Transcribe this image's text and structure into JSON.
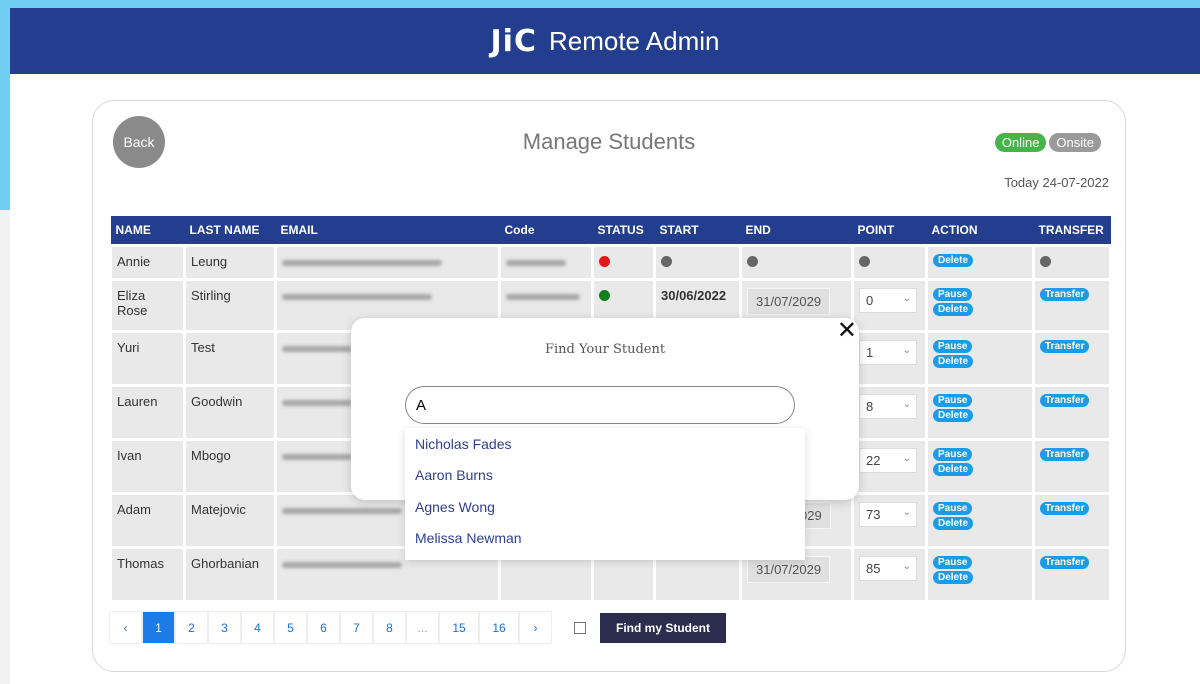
{
  "header": {
    "logo": "JiC",
    "title": "Remote Admin"
  },
  "card": {
    "back_label": "Back",
    "title": "Manage Students",
    "toggles": {
      "online": "Online",
      "onsite": "Onsite"
    },
    "today": "Today 24-07-2022"
  },
  "table": {
    "columns": [
      "NAME",
      "LAST NAME",
      "EMAIL",
      "Code",
      "STATUS",
      "START",
      "END",
      "POINT",
      "ACTION",
      "TRANSFER"
    ],
    "rows": [
      {
        "name": "Annie",
        "last": "Leung",
        "status": "red",
        "start": "",
        "end": "",
        "point": "",
        "actions": [
          "Delete"
        ],
        "transfer": ""
      },
      {
        "name": "Eliza Rose",
        "last": "Stirling",
        "status": "green",
        "start": "30/06/2022",
        "end": "31/07/2029",
        "point": "0",
        "actions": [
          "Pause",
          "Delete"
        ],
        "transfer": "Transfer"
      },
      {
        "name": "Yuri",
        "last": "Test",
        "status": "",
        "start": "",
        "end": "",
        "point": "1",
        "actions": [
          "Pause",
          "Delete"
        ],
        "transfer": "Transfer"
      },
      {
        "name": "Lauren",
        "last": "Goodwin",
        "status": "",
        "start": "",
        "end": "",
        "point": "8",
        "actions": [
          "Pause",
          "Delete"
        ],
        "transfer": "Transfer"
      },
      {
        "name": "Ivan",
        "last": "Mbogo",
        "status": "",
        "start": "",
        "end": "",
        "point": "22",
        "actions": [
          "Pause",
          "Delete"
        ],
        "transfer": "Transfer"
      },
      {
        "name": "Adam",
        "last": "Matejovic",
        "status": "",
        "start": "",
        "end": "029",
        "point": "73",
        "actions": [
          "Pause",
          "Delete"
        ],
        "transfer": "Transfer"
      },
      {
        "name": "Thomas",
        "last": "Ghorbanian",
        "status": "",
        "start": "",
        "end": "31/07/2029",
        "point": "85",
        "actions": [
          "Pause",
          "Delete"
        ],
        "transfer": "Transfer"
      }
    ]
  },
  "pagination": {
    "prev": "‹",
    "pages": [
      "1",
      "2",
      "3",
      "4",
      "5",
      "6",
      "7",
      "8",
      "...",
      "15",
      "16"
    ],
    "next": "›",
    "active": "1"
  },
  "find_button": "Find my Student",
  "modal": {
    "title": "Find Your Student",
    "close": "✕",
    "search_value": "A",
    "suggestions": [
      "Nicholas Fades",
      "Aaron Burns",
      "Agnes Wong",
      "Melissa Newman"
    ]
  },
  "colors": {
    "header": "#233e8e",
    "accent_blue": "#1c9ce6",
    "online": "#46b549",
    "onsite": "#9a9a9a",
    "status_red": "#e5161b",
    "status_green": "#11801f"
  }
}
